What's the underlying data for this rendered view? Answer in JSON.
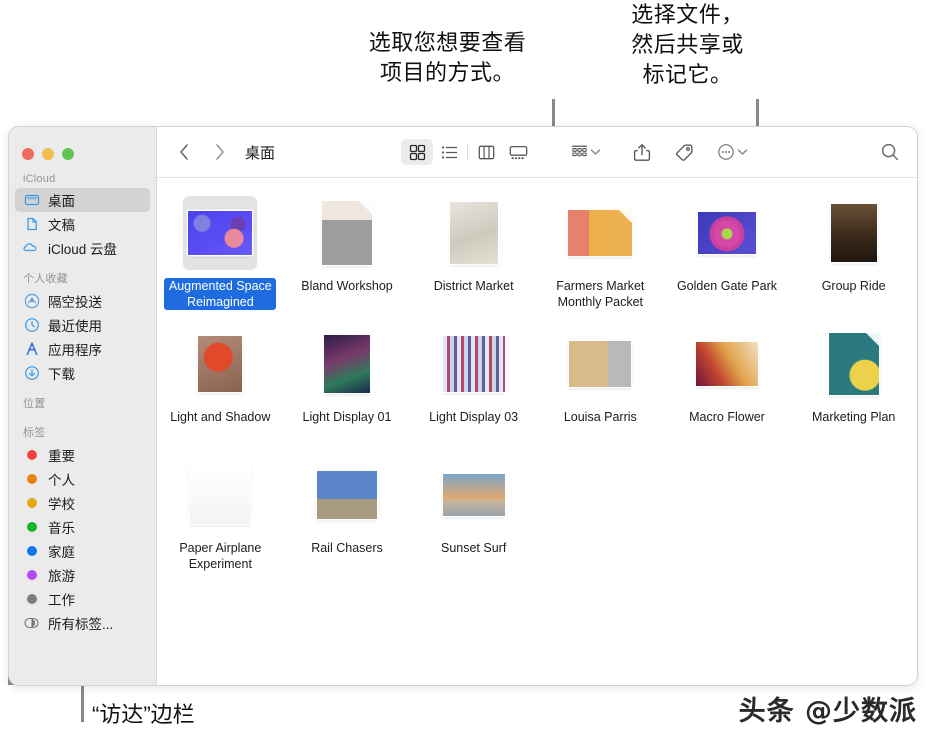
{
  "annotations": {
    "view_options": "选取您想要查看\n项目的方式。",
    "share_tag": "选择文件，\n然后共享或\n标记它。",
    "sidebar": "“访达”边栏"
  },
  "watermark": "头条 @少数派",
  "window": {
    "traffic_lights": {
      "close": "close-button",
      "minimize": "minimize-button",
      "zoom": "zoom-button",
      "close_color": "#ec6a5e",
      "minimize_color": "#f4bd4f",
      "zoom_color": "#61c454"
    }
  },
  "sidebar": {
    "sections": [
      {
        "title": "iCloud",
        "items": [
          {
            "label": "桌面",
            "icon": "desktop-icon",
            "selected": true
          },
          {
            "label": "文稿",
            "icon": "document-icon",
            "selected": false
          },
          {
            "label": "iCloud 云盘",
            "icon": "cloud-icon",
            "selected": false
          }
        ]
      },
      {
        "title": "个人收藏",
        "items": [
          {
            "label": "隔空投送",
            "icon": "airdrop-icon",
            "selected": false
          },
          {
            "label": "最近使用",
            "icon": "clock-icon",
            "selected": false
          },
          {
            "label": "应用程序",
            "icon": "applications-icon",
            "selected": false
          },
          {
            "label": "下载",
            "icon": "downloads-icon",
            "selected": false
          }
        ]
      },
      {
        "title": "位置",
        "items": []
      },
      {
        "title": "标签",
        "items": [
          {
            "label": "重要",
            "icon": "tag-dot-icon",
            "color": "#f4433c",
            "selected": false
          },
          {
            "label": "个人",
            "icon": "tag-dot-icon",
            "color": "#e8820c",
            "selected": false
          },
          {
            "label": "学校",
            "icon": "tag-dot-icon",
            "color": "#e0a80d",
            "selected": false
          },
          {
            "label": "音乐",
            "icon": "tag-dot-icon",
            "color": "#16b52a",
            "selected": false
          },
          {
            "label": "家庭",
            "icon": "tag-dot-icon",
            "color": "#1177f0",
            "selected": false
          },
          {
            "label": "旅游",
            "icon": "tag-dot-icon",
            "color": "#b04cf0",
            "selected": false
          },
          {
            "label": "工作",
            "icon": "tag-dot-icon",
            "color": "#7d7d7d",
            "selected": false
          },
          {
            "label": "所有标签...",
            "icon": "all-tags-icon",
            "color": "",
            "selected": false
          }
        ]
      }
    ]
  },
  "toolbar": {
    "back": "back-button",
    "forward": "forward-button",
    "path_title": "桌面",
    "view_buttons": [
      {
        "name": "icon-view",
        "active": true
      },
      {
        "name": "list-view",
        "active": false
      },
      {
        "name": "column-view",
        "active": false
      },
      {
        "name": "gallery-view",
        "active": false
      }
    ],
    "group_by": "group-by-button",
    "share": "share-button",
    "tag": "tag-button",
    "more": "more-actions-button",
    "search": "search-button"
  },
  "items": [
    {
      "name": "Augmented Space Reimagined",
      "thumb": "t-aug",
      "fold": false,
      "selected": true
    },
    {
      "name": "Bland Workshop",
      "thumb": "t-bland",
      "fold": true,
      "selected": false
    },
    {
      "name": "District Market",
      "thumb": "t-district",
      "fold": false,
      "selected": false
    },
    {
      "name": "Farmers Market Monthly Packet",
      "thumb": "t-farmers",
      "fold": true,
      "selected": false
    },
    {
      "name": "Golden Gate Park",
      "thumb": "t-golden",
      "fold": false,
      "selected": false
    },
    {
      "name": "Group Ride",
      "thumb": "t-group",
      "fold": false,
      "selected": false
    },
    {
      "name": "Light and Shadow",
      "thumb": "t-lightshadow",
      "fold": false,
      "selected": false
    },
    {
      "name": "Light Display 01",
      "thumb": "t-ld01",
      "fold": false,
      "selected": false
    },
    {
      "name": "Light Display 03",
      "thumb": "t-ld03",
      "fold": false,
      "selected": false
    },
    {
      "name": "Louisa Parris",
      "thumb": "t-louisa",
      "fold": false,
      "selected": false
    },
    {
      "name": "Macro Flower",
      "thumb": "t-macro",
      "fold": false,
      "selected": false
    },
    {
      "name": "Marketing Plan",
      "thumb": "t-marketing",
      "fold": true,
      "selected": false
    },
    {
      "name": "Paper Airplane Experiment",
      "thumb": "t-paper",
      "fold": true,
      "selected": false
    },
    {
      "name": "Rail Chasers",
      "thumb": "t-rail",
      "fold": false,
      "selected": false
    },
    {
      "name": "Sunset Surf",
      "thumb": "t-sunset",
      "fold": false,
      "selected": false
    }
  ]
}
